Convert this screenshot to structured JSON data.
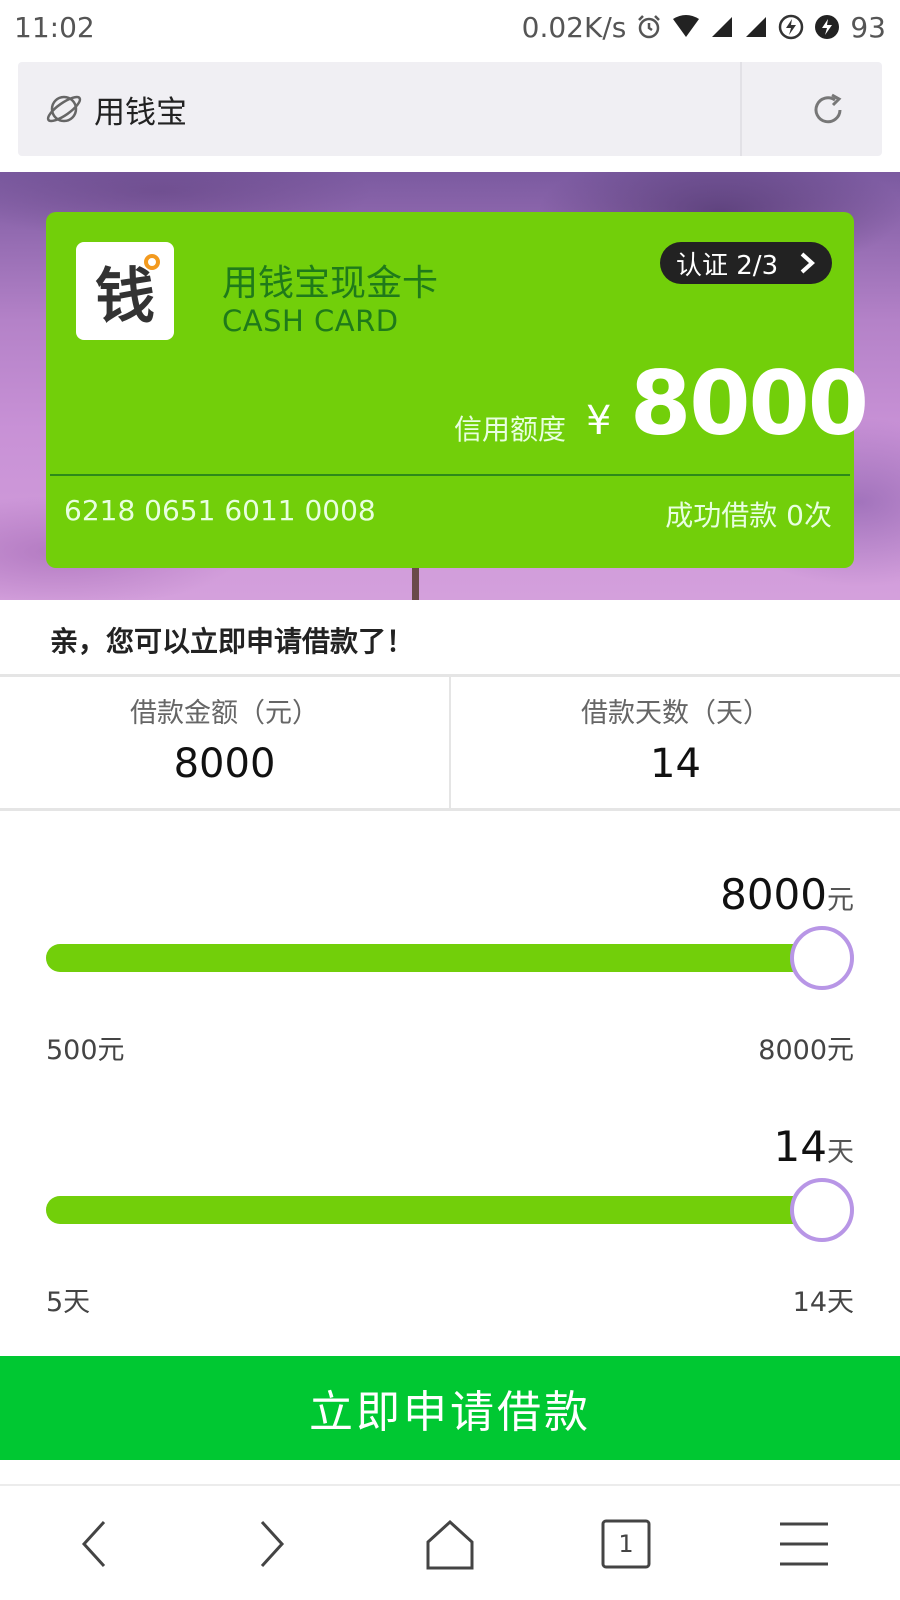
{
  "status_bar": {
    "time": "11:02",
    "network_speed": "0.02K/s",
    "battery": "93",
    "icons": [
      "alarm-icon",
      "wifi-icon",
      "signal-icon",
      "signal-icon",
      "charging-icon",
      "battery-saver-icon"
    ]
  },
  "address_bar": {
    "title": "用钱宝",
    "site_icon": "planet-icon",
    "refresh_icon": "refresh-icon"
  },
  "card": {
    "logo_char": "钱",
    "name": "用钱宝现金卡",
    "name_en": "CASH CARD",
    "verify_label": "认证 2/3",
    "limit_label": "信用额度",
    "currency": "¥",
    "limit_value": "8000",
    "card_number": "6218 0651 6011 0008",
    "loan_count": "成功借款 0次",
    "color": "#72cf0a"
  },
  "prompt": "亲，您可以立即申请借款了！",
  "info": {
    "amount_label": "借款金额（元）",
    "amount_value": "8000",
    "days_label": "借款天数（天）",
    "days_value": "14"
  },
  "amount_slider": {
    "current": "8000",
    "unit": "元",
    "min_label": "500元",
    "max_label": "8000元",
    "min": 500,
    "max": 8000,
    "value": 8000
  },
  "days_slider": {
    "current": "14",
    "unit": "天",
    "min_label": "5天",
    "max_label": "14天",
    "min": 5,
    "max": 14,
    "value": 14
  },
  "apply_button": "立即申请借款",
  "bottom_nav": {
    "tab_count": "1",
    "items": [
      "back-icon",
      "forward-icon",
      "home-icon",
      "tabs-icon",
      "menu-icon"
    ]
  },
  "colors": {
    "accent_green": "#72cf0a",
    "button_green": "#00c832",
    "thumb_border": "#b896e6"
  }
}
